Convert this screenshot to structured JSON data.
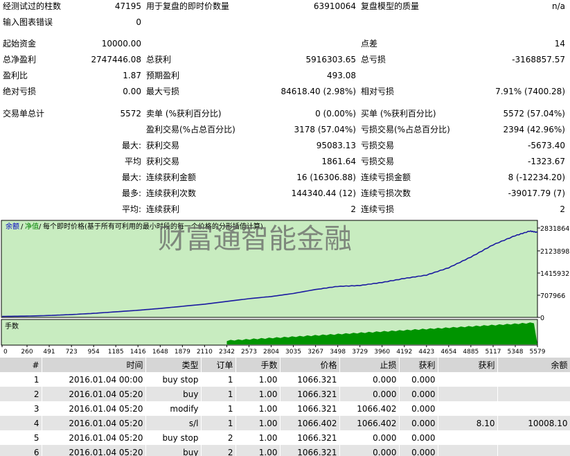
{
  "report": {
    "rows": [
      {
        "y": 9,
        "cells": [
          {
            "x": 4,
            "w": 120,
            "t": "经测试过的柱数",
            "a": "l"
          },
          {
            "x": 124,
            "w": 80,
            "t": "47195",
            "a": "r"
          },
          {
            "x": 211,
            "w": 160,
            "t": "用于复盘的即时价数量",
            "a": "l"
          },
          {
            "x": 380,
            "w": 134,
            "t": "63910064",
            "a": "r"
          },
          {
            "x": 521,
            "w": 160,
            "t": "复盘模型的质量",
            "a": "l"
          },
          {
            "x": 700,
            "w": 116,
            "t": "n/a",
            "a": "r"
          }
        ]
      },
      {
        "y": 32,
        "cells": [
          {
            "x": 4,
            "w": 120,
            "t": "输入图表错误",
            "a": "l"
          },
          {
            "x": 124,
            "w": 80,
            "t": "0",
            "a": "r"
          }
        ]
      },
      {
        "y": 63,
        "cells": [
          {
            "x": 4,
            "w": 120,
            "t": "起始资金",
            "a": "l"
          },
          {
            "x": 100,
            "w": 104,
            "t": "10000.00",
            "a": "r"
          },
          {
            "x": 521,
            "w": 80,
            "t": "点差",
            "a": "l"
          },
          {
            "x": 700,
            "w": 116,
            "t": "14",
            "a": "r"
          }
        ]
      },
      {
        "y": 86,
        "cells": [
          {
            "x": 4,
            "w": 120,
            "t": "总净盈利",
            "a": "l"
          },
          {
            "x": 100,
            "w": 104,
            "t": "2747446.08",
            "a": "r"
          },
          {
            "x": 211,
            "w": 100,
            "t": "总获利",
            "a": "l"
          },
          {
            "x": 380,
            "w": 134,
            "t": "5916303.65",
            "a": "r"
          },
          {
            "x": 521,
            "w": 80,
            "t": "总亏损",
            "a": "l"
          },
          {
            "x": 680,
            "w": 136,
            "t": "-3168857.57",
            "a": "r"
          }
        ]
      },
      {
        "y": 109,
        "cells": [
          {
            "x": 4,
            "w": 120,
            "t": "盈利比",
            "a": "l"
          },
          {
            "x": 124,
            "w": 80,
            "t": "1.87",
            "a": "r"
          },
          {
            "x": 211,
            "w": 100,
            "t": "预期盈利",
            "a": "l"
          },
          {
            "x": 380,
            "w": 134,
            "t": "493.08",
            "a": "r"
          }
        ]
      },
      {
        "y": 132,
        "cells": [
          {
            "x": 4,
            "w": 120,
            "t": "绝对亏损",
            "a": "l"
          },
          {
            "x": 124,
            "w": 80,
            "t": "0.00",
            "a": "r"
          },
          {
            "x": 211,
            "w": 100,
            "t": "最大亏损",
            "a": "l"
          },
          {
            "x": 360,
            "w": 154,
            "t": "84618.40 (2.98%)",
            "a": "r"
          },
          {
            "x": 521,
            "w": 80,
            "t": "相对亏损",
            "a": "l"
          },
          {
            "x": 660,
            "w": 156,
            "t": "7.91% (7400.28)",
            "a": "r"
          }
        ]
      },
      {
        "y": 164,
        "cells": [
          {
            "x": 4,
            "w": 120,
            "t": "交易单总计",
            "a": "l"
          },
          {
            "x": 124,
            "w": 80,
            "t": "5572",
            "a": "r"
          },
          {
            "x": 211,
            "w": 160,
            "t": "卖单 (%获利百分比)",
            "a": "l"
          },
          {
            "x": 380,
            "w": 134,
            "t": "0 (0.00%)",
            "a": "r"
          },
          {
            "x": 521,
            "w": 160,
            "t": "买单 (%获利百分比)",
            "a": "l"
          },
          {
            "x": 680,
            "w": 136,
            "t": "5572 (57.04%)",
            "a": "r"
          }
        ]
      },
      {
        "y": 187,
        "cells": [
          {
            "x": 211,
            "w": 160,
            "t": "盈利交易(%占总百分比)",
            "a": "l"
          },
          {
            "x": 360,
            "w": 154,
            "t": "3178 (57.04%)",
            "a": "r"
          },
          {
            "x": 521,
            "w": 160,
            "t": "亏损交易(%占总百分比)",
            "a": "l"
          },
          {
            "x": 680,
            "w": 136,
            "t": "2394 (42.96%)",
            "a": "r"
          }
        ]
      },
      {
        "y": 210,
        "cells": [
          {
            "x": 124,
            "w": 80,
            "t": "最大:",
            "a": "r"
          },
          {
            "x": 211,
            "w": 100,
            "t": "获利交易",
            "a": "l"
          },
          {
            "x": 380,
            "w": 134,
            "t": "95083.13",
            "a": "r"
          },
          {
            "x": 521,
            "w": 100,
            "t": "亏损交易",
            "a": "l"
          },
          {
            "x": 680,
            "w": 136,
            "t": "-5673.40",
            "a": "r"
          }
        ]
      },
      {
        "y": 233,
        "cells": [
          {
            "x": 124,
            "w": 80,
            "t": "平均",
            "a": "r"
          },
          {
            "x": 211,
            "w": 100,
            "t": "获利交易",
            "a": "l"
          },
          {
            "x": 380,
            "w": 134,
            "t": "1861.64",
            "a": "r"
          },
          {
            "x": 521,
            "w": 100,
            "t": "亏损交易",
            "a": "l"
          },
          {
            "x": 680,
            "w": 136,
            "t": "-1323.67",
            "a": "r"
          }
        ]
      },
      {
        "y": 256,
        "cells": [
          {
            "x": 124,
            "w": 80,
            "t": "最大:",
            "a": "r"
          },
          {
            "x": 211,
            "w": 160,
            "t": "连续获利金额",
            "a": "l"
          },
          {
            "x": 360,
            "w": 154,
            "t": "16 (16306.88)",
            "a": "r"
          },
          {
            "x": 521,
            "w": 160,
            "t": "连续亏损金额",
            "a": "l"
          },
          {
            "x": 680,
            "w": 136,
            "t": "8 (-12234.20)",
            "a": "r"
          }
        ]
      },
      {
        "y": 279,
        "cells": [
          {
            "x": 124,
            "w": 80,
            "t": "最多:",
            "a": "r"
          },
          {
            "x": 211,
            "w": 160,
            "t": "连续获利次数",
            "a": "l"
          },
          {
            "x": 360,
            "w": 154,
            "t": "144340.44 (12)",
            "a": "r"
          },
          {
            "x": 521,
            "w": 160,
            "t": "连续亏损次数",
            "a": "l"
          },
          {
            "x": 680,
            "w": 136,
            "t": "-39017.79 (7)",
            "a": "r"
          }
        ]
      },
      {
        "y": 302,
        "cells": [
          {
            "x": 124,
            "w": 80,
            "t": "平均:",
            "a": "r"
          },
          {
            "x": 211,
            "w": 100,
            "t": "连续获利",
            "a": "l"
          },
          {
            "x": 380,
            "w": 134,
            "t": "2",
            "a": "r"
          },
          {
            "x": 521,
            "w": 100,
            "t": "连续亏损",
            "a": "l"
          },
          {
            "x": 700,
            "w": 116,
            "t": "2",
            "a": "r"
          }
        ]
      }
    ]
  },
  "chart": {
    "legend_balance": "余额",
    "legend_sep1": "/",
    "legend_equity": "净值",
    "legend_sep2": "/",
    "legend_model": "每个即时价格(基于所有可利用的最小时段的每一个价格的分形插值计算)",
    "watermark": "财富通智能金融",
    "volume_label": "手数",
    "y_ticks": [
      "2831864",
      "2123898",
      "1415932",
      "707966",
      "0"
    ],
    "x_ticks": [
      "0",
      "260",
      "491",
      "723",
      "954",
      "1185",
      "1416",
      "1648",
      "1879",
      "2110",
      "2342",
      "2573",
      "2804",
      "3035",
      "3267",
      "3498",
      "3729",
      "3960",
      "4192",
      "4423",
      "4654",
      "4885",
      "5117",
      "5348",
      "5579"
    ],
    "colors": {
      "panel_bg": "#c8ecc0",
      "balance": "#1a1aa0",
      "volume": "#009400",
      "legend_blue": "#0000c0",
      "legend_green": "#008000"
    }
  },
  "chart_data": {
    "type": "line",
    "title": "",
    "series": [
      {
        "x": [
          0,
          260,
          491,
          723,
          954,
          1185,
          1416,
          1648,
          1879,
          2110,
          2342,
          2573,
          2804,
          3035,
          3267,
          3498,
          3729,
          3960,
          4192,
          4423,
          4654,
          4885,
          5117,
          5348,
          5500,
          5579
        ],
        "values": [
          10000,
          20000,
          40000,
          70000,
          110000,
          160000,
          210000,
          270000,
          340000,
          410000,
          500000,
          590000,
          660000,
          760000,
          890000,
          990000,
          1020000,
          1120000,
          1250000,
          1360000,
          1600000,
          1950000,
          2350000,
          2650000,
          2800000,
          2757446
        ]
      }
    ],
    "ylim": [
      0,
      2831864
    ],
    "xlim": [
      0,
      5579
    ]
  },
  "table": {
    "headers": [
      "#",
      "时间",
      "类型",
      "订单",
      "手数",
      "价格",
      "止损",
      "获利",
      "获利",
      "余额"
    ],
    "rows": [
      [
        "1",
        "2016.01.04 00:00",
        "buy stop",
        "1",
        "1.00",
        "1066.321",
        "0.000",
        "0.000",
        "",
        ""
      ],
      [
        "2",
        "2016.01.04 05:20",
        "buy",
        "1",
        "1.00",
        "1066.321",
        "0.000",
        "0.000",
        "",
        ""
      ],
      [
        "3",
        "2016.01.04 05:20",
        "modify",
        "1",
        "1.00",
        "1066.321",
        "1066.402",
        "0.000",
        "",
        ""
      ],
      [
        "4",
        "2016.01.04 05:20",
        "s/l",
        "1",
        "1.00",
        "1066.402",
        "1066.402",
        "0.000",
        "8.10",
        "10008.10"
      ],
      [
        "5",
        "2016.01.04 05:20",
        "buy stop",
        "2",
        "1.00",
        "1066.321",
        "0.000",
        "0.000",
        "",
        ""
      ],
      [
        "6",
        "2016.01.04 05:20",
        "buy",
        "2",
        "1.00",
        "1066.321",
        "0.000",
        "0.000",
        "",
        ""
      ]
    ]
  }
}
